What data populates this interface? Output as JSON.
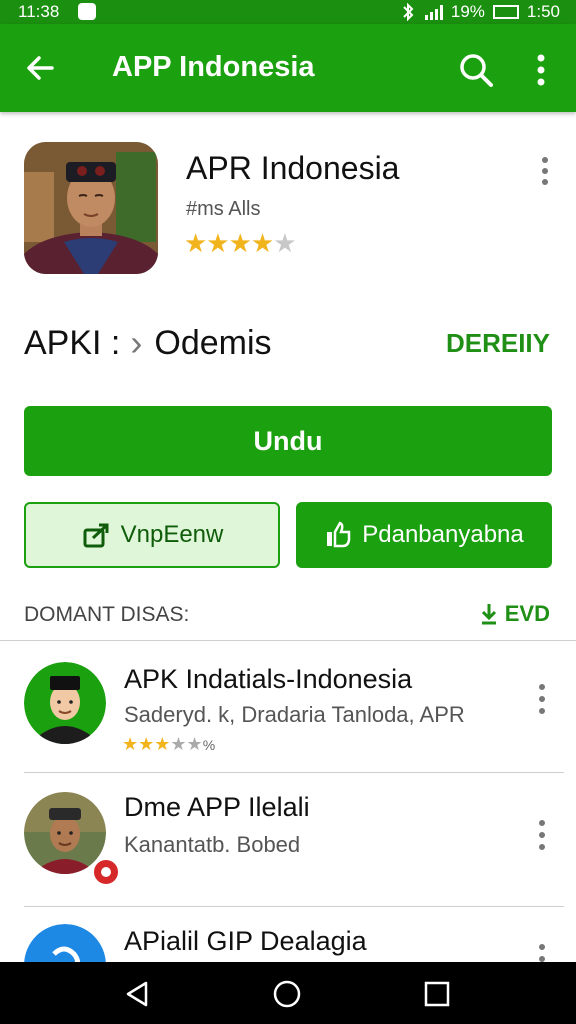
{
  "status_bar": {
    "time_left": "11:38",
    "battery": "19%",
    "time_right": "1:50"
  },
  "app_bar": {
    "title": "APP Indonesia",
    "icons": [
      "back-arrow-icon",
      "search-icon",
      "more-vert-icon"
    ]
  },
  "app_header": {
    "title": "APR Indonesia",
    "developer": "#ms Alls",
    "rating": "★★★★",
    "rating_off": "★"
  },
  "breadcrumb": {
    "first": "APKI :",
    "separator": "›",
    "second": "Odemis",
    "action": "DEREIIY"
  },
  "buttons": {
    "primary": "Undu",
    "secondary_left": "VnpEenw",
    "secondary_right": "Pdanbanyabna"
  },
  "section": {
    "title": "DOMANT DISAS:",
    "link": "EVD"
  },
  "list": [
    {
      "name": "APK Indatials-Indonesia",
      "subtitle": "Saderyd. k, Dradaria Tanloda, APR",
      "stars_on": "★★★",
      "stars_off": "★★",
      "count": "%"
    },
    {
      "name": "Dme APP Ilelali",
      "subtitle": "Kanantatb. Bobed"
    },
    {
      "name": "APialil GIP Dealagia"
    }
  ],
  "colors": {
    "primary": "#1ba00f",
    "status": "#1b8f0f",
    "accent_text": "#1f8f16",
    "star": "#f2b41c"
  }
}
